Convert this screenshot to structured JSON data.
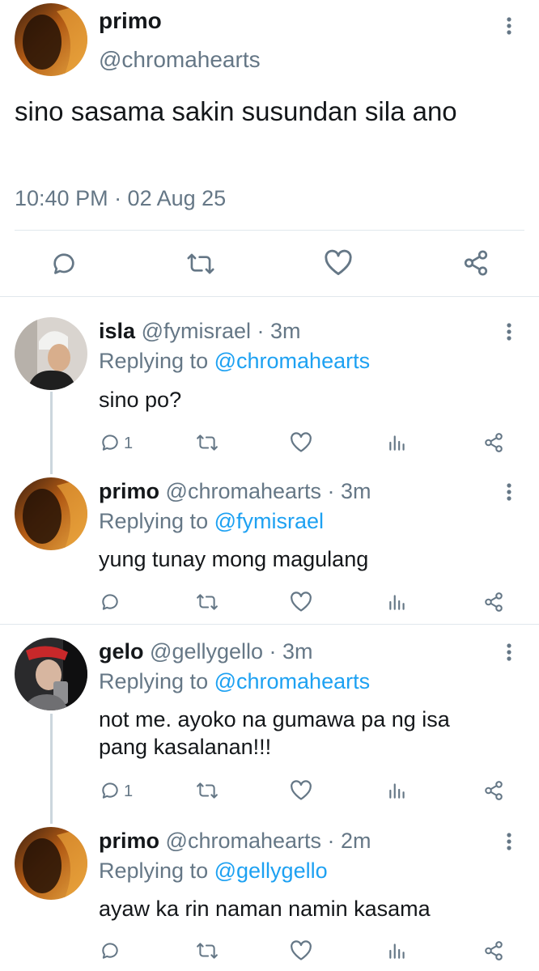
{
  "main_tweet": {
    "name": "primo",
    "handle": "@chromahearts",
    "text": "sino sasama sakin susundan sila ano",
    "timestamp": "10:40 PM · 02 Aug 25",
    "actions": [
      "comment-icon",
      "retweet-icon",
      "like-icon",
      "share-icon"
    ]
  },
  "replies": [
    {
      "name": "isla",
      "handle": "@fymisrael",
      "time": "· 3m",
      "replying_prefix": "Replying to",
      "replying_to": "@chromahearts",
      "text": "sino po?",
      "reply_count": "1"
    },
    {
      "name": "primo",
      "handle": "@chromahearts",
      "time": "· 3m",
      "replying_prefix": "Replying to",
      "replying_to": "@fymisrael",
      "text": "yung tunay mong magulang",
      "reply_count": ""
    },
    {
      "name": "gelo",
      "handle": "@gellygello",
      "time": "· 3m",
      "replying_prefix": "Replying to",
      "replying_to": "@chromahearts",
      "text": "not me. ayoko na gumawa pa ng isa pang kasalanan!!!",
      "reply_count": "1"
    },
    {
      "name": "primo",
      "handle": "@chromahearts",
      "time": "· 2m",
      "replying_prefix": "Replying to",
      "replying_to": "@gellygello",
      "text": "ayaw ka rin naman namin kasama",
      "reply_count": ""
    }
  ],
  "colors": {
    "link": "#1da1f2",
    "muted": "#657786",
    "divider": "#e1e8ed"
  }
}
